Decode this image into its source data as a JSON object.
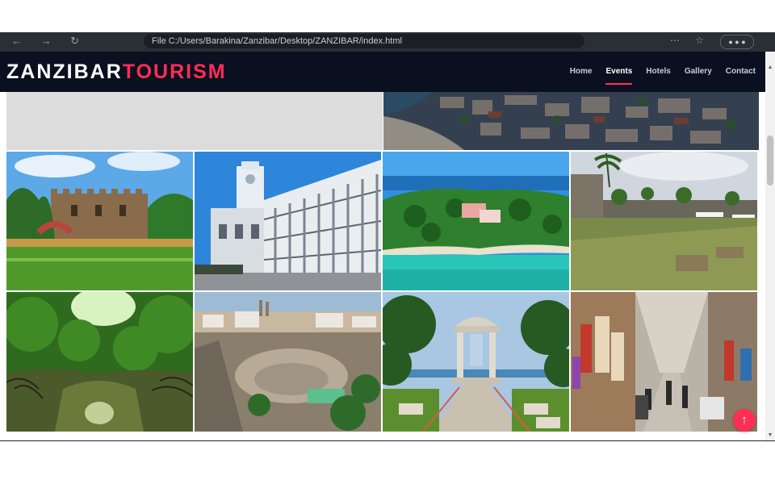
{
  "browser": {
    "address": "File   C:/Users/Barakina/Zanzibar/Desktop/ZANZIBAR/index.html",
    "nav_glyphs": "← → ↻",
    "right_glyphs": "⋯ ☆",
    "pill": "● ● ●"
  },
  "header": {
    "logo_part1": "ZANZIBAR",
    "logo_part2": "TOURISM",
    "nav": [
      {
        "label": "Home"
      },
      {
        "label": "Events",
        "active": true
      },
      {
        "label": "Hotels"
      },
      {
        "label": "Gallery"
      },
      {
        "label": "Contact"
      }
    ]
  },
  "gallery": {
    "images": [
      {
        "subject": "placeholder-gray"
      },
      {
        "subject": "aerial-stone-town-coast"
      },
      {
        "subject": "old-fort-garden"
      },
      {
        "subject": "house-of-wonders"
      },
      {
        "subject": "island-lagoon-aerial"
      },
      {
        "subject": "fort-ruins-courtyard"
      },
      {
        "subject": "mangrove-forest"
      },
      {
        "subject": "stone-town-amphitheatre"
      },
      {
        "subject": "forodhani-gazebo"
      },
      {
        "subject": "market-street"
      }
    ]
  },
  "back_to_top": {
    "label": "↑"
  },
  "colors": {
    "header_bg": "#0b1020",
    "accent": "#ff2e55",
    "nav_text": "#c8ccd4"
  }
}
